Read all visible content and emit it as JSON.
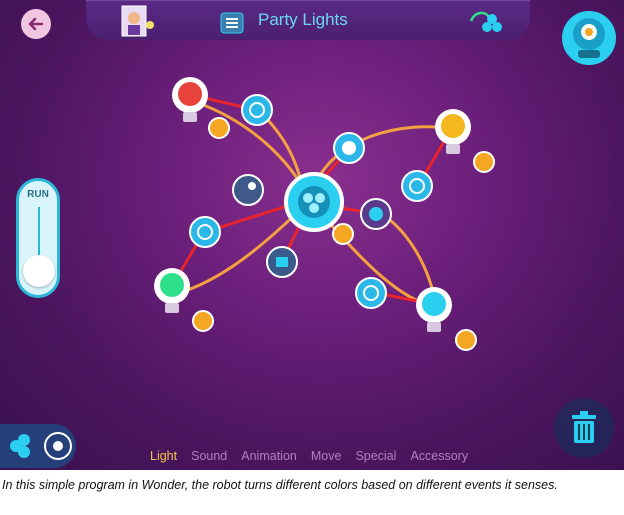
{
  "header": {
    "title": "Party Lights"
  },
  "palette_tabs": [
    {
      "label": "Light",
      "active": true
    },
    {
      "label": "Sound",
      "active": false
    },
    {
      "label": "Animation",
      "active": false
    },
    {
      "label": "Move",
      "active": false
    },
    {
      "label": "Special",
      "active": false
    },
    {
      "label": "Accessory",
      "active": false
    }
  ],
  "run_control": {
    "label": "RUN"
  },
  "caption": "In this simple program in Wonder, the robot turns different colors based on different events it senses.",
  "colors": {
    "accent_cyan": "#2bd0f0",
    "active_tab": "#f2c84b",
    "wire_red": "#e8232e",
    "wire_orange": "#f5a040"
  }
}
